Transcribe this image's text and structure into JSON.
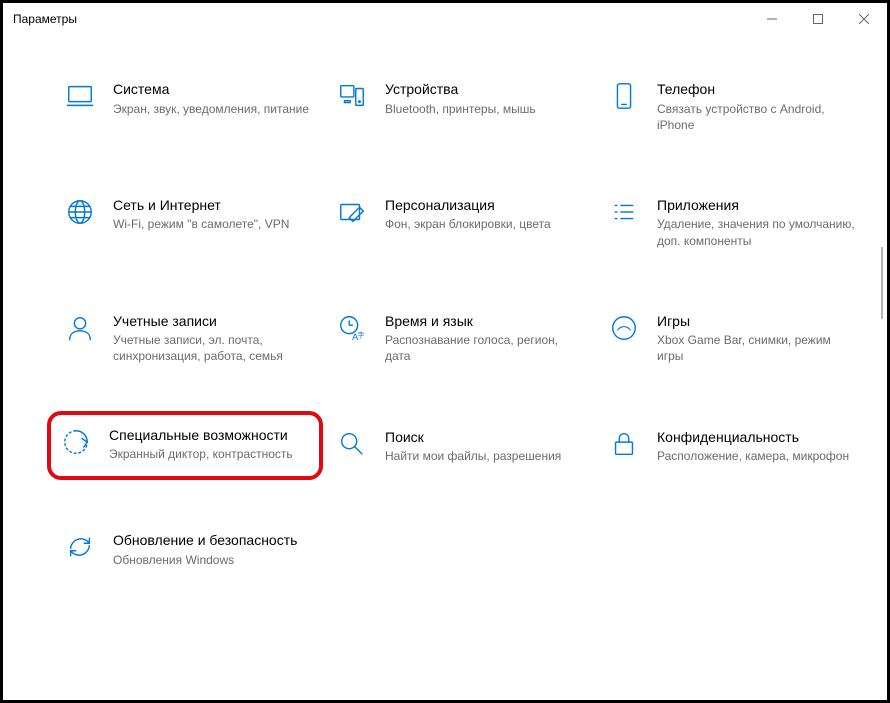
{
  "window": {
    "title": "Параметры"
  },
  "tiles": {
    "system": {
      "title": "Система",
      "desc": "Экран, звук, уведомления, питание"
    },
    "devices": {
      "title": "Устройства",
      "desc": "Bluetooth, принтеры, мышь"
    },
    "phone": {
      "title": "Телефон",
      "desc": "Связать устройство с Android, iPhone"
    },
    "network": {
      "title": "Сеть и Интернет",
      "desc": "Wi-Fi, режим \"в самолете\", VPN"
    },
    "personalization": {
      "title": "Персонализация",
      "desc": "Фон, экран блокировки, цвета"
    },
    "apps": {
      "title": "Приложения",
      "desc": "Удаление, значения по умолчанию, доп. компоненты"
    },
    "accounts": {
      "title": "Учетные записи",
      "desc": "Учетные записи, эл. почта, синхронизация, работа, семья"
    },
    "time": {
      "title": "Время и язык",
      "desc": "Распознавание голоса, регион, дата"
    },
    "gaming": {
      "title": "Игры",
      "desc": "Xbox Game Bar, снимки, режим игры"
    },
    "ease": {
      "title": "Специальные возможности",
      "desc": "Экранный диктор, контрастность"
    },
    "search": {
      "title": "Поиск",
      "desc": "Найти мои файлы, разрешения"
    },
    "privacy": {
      "title": "Конфиденциальность",
      "desc": "Расположение, камера, микрофон"
    },
    "update": {
      "title": "Обновление и безопасность",
      "desc": "Обновления Windows"
    }
  }
}
